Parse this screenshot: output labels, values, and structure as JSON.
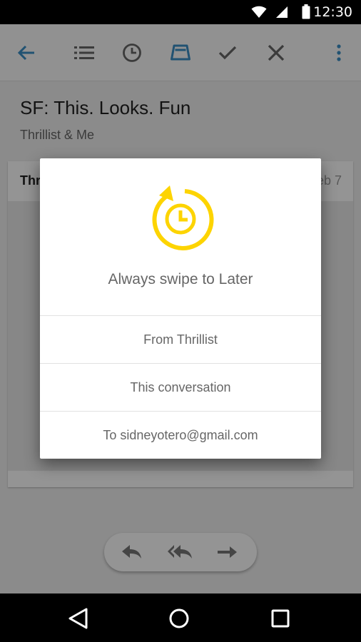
{
  "status_bar": {
    "time": "12:30",
    "icons": [
      "wifi-icon",
      "cell-signal-icon",
      "battery-icon"
    ]
  },
  "toolbar": {
    "icons": [
      "back-arrow-icon",
      "list-icon",
      "clock-icon",
      "inbox-tray-icon",
      "check-icon",
      "close-icon",
      "overflow-menu-icon"
    ],
    "accent_color": "#3a8ec4"
  },
  "conversation": {
    "subject": "SF: This. Looks. Fun",
    "participants": "Thrillist & Me",
    "sender_partial": "Thr",
    "date_partial": "eb 7"
  },
  "dialog": {
    "icon": "swipe-later-clock-icon",
    "icon_color": "#fdd400",
    "title": "Always swipe to Later",
    "options": [
      {
        "label": "From Thrillist"
      },
      {
        "label": "This conversation"
      },
      {
        "label": "To sidneyotero@gmail.com"
      }
    ]
  },
  "reply_bar": {
    "icons": [
      "reply-icon",
      "reply-all-icon",
      "forward-icon"
    ]
  },
  "nav_bar": {
    "icons": [
      "back-triangle-icon",
      "home-circle-icon",
      "recents-square-icon"
    ]
  }
}
